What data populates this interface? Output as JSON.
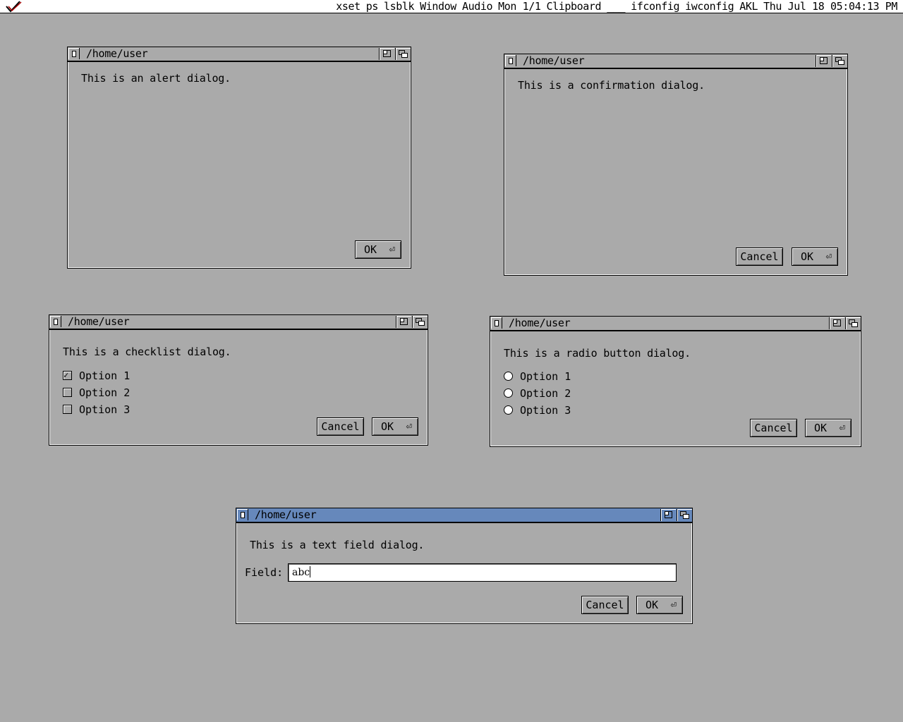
{
  "menubar": {
    "items": [
      "xset",
      "ps",
      "lsblk",
      "Window",
      "Audio",
      "Mon 1/1",
      "Clipboard",
      "___",
      "ifconfig",
      "iwconfig",
      "AKL",
      "Thu Jul 18 05:04:13 PM"
    ]
  },
  "dialogs": {
    "alert": {
      "title": "/home/user",
      "message": "This is an alert dialog.",
      "ok_label": "OK"
    },
    "confirm": {
      "title": "/home/user",
      "message": "This is a confirmation dialog.",
      "cancel_label": "Cancel",
      "ok_label": "OK"
    },
    "checklist": {
      "title": "/home/user",
      "message": "This is a checklist dialog.",
      "options": [
        {
          "label": "Option 1",
          "checked": true
        },
        {
          "label": "Option 2",
          "checked": false
        },
        {
          "label": "Option 3",
          "checked": false
        }
      ],
      "cancel_label": "Cancel",
      "ok_label": "OK"
    },
    "radio": {
      "title": "/home/user",
      "message": "This is a radio button dialog.",
      "options": [
        {
          "label": "Option 1"
        },
        {
          "label": "Option 2"
        },
        {
          "label": "Option 3"
        }
      ],
      "cancel_label": "Cancel",
      "ok_label": "OK"
    },
    "textfield": {
      "title": "/home/user",
      "message": "This is a text field dialog.",
      "field_label": "Field:",
      "field_value": "abc",
      "cancel_label": "Cancel",
      "ok_label": "OK"
    }
  },
  "colors": {
    "desktop": "#aaaaaa",
    "active_titlebar": "#6688bb"
  },
  "icons": {
    "return": "return-arrow-icon"
  }
}
